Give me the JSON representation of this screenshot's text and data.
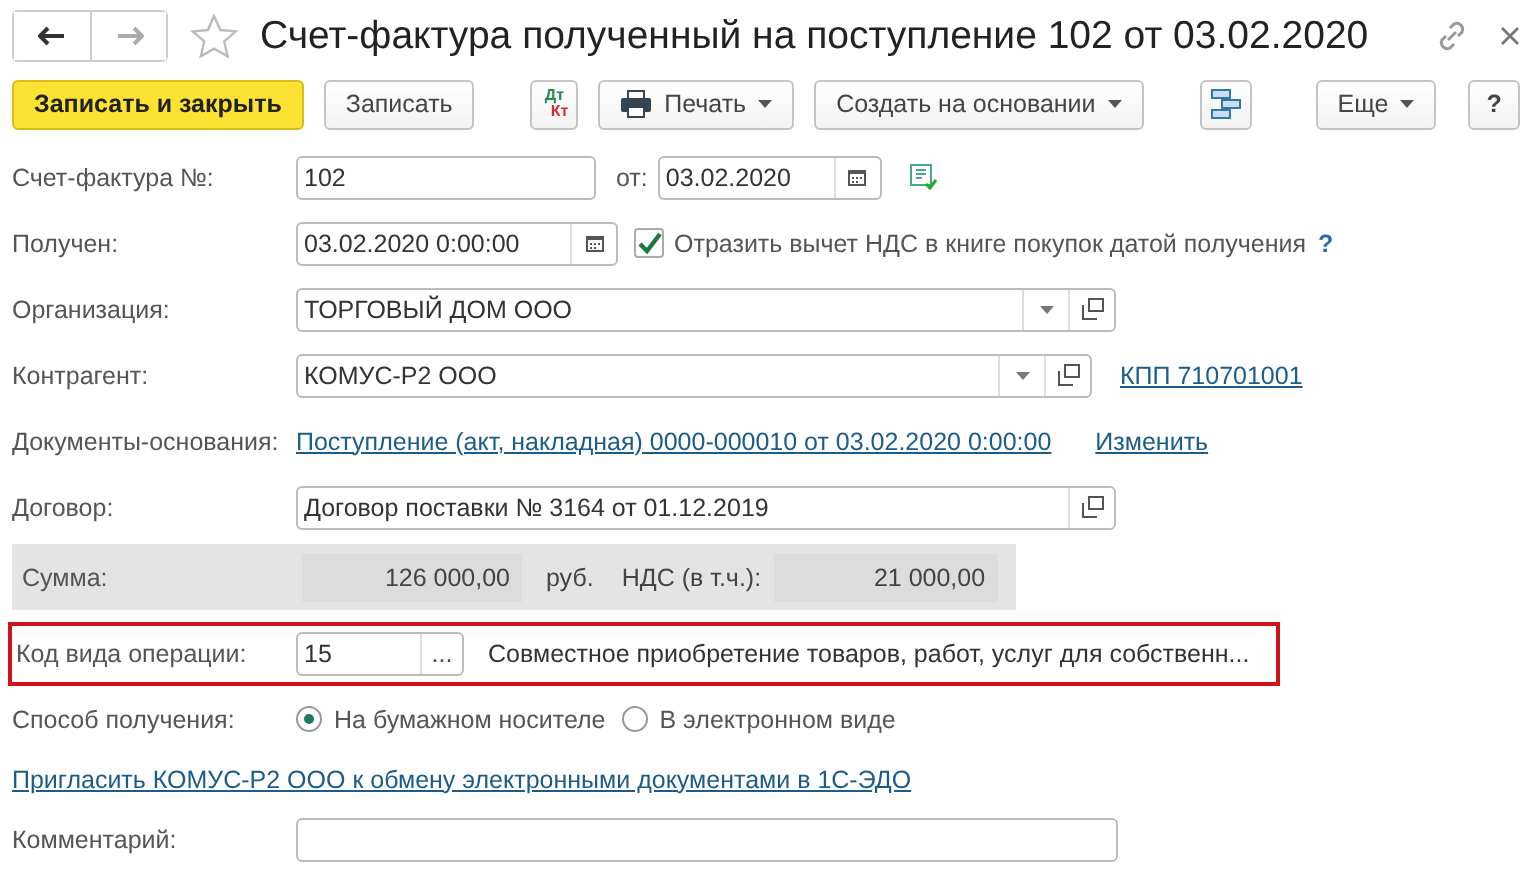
{
  "title": "Счет-фактура полученный на поступление 102 от 03.02.2020",
  "toolbar": [
    {
      "kind": "primary",
      "label": "Записать и закрыть"
    },
    {
      "kind": "button",
      "label": "Записать"
    },
    {
      "kind": "dtkt",
      "label": "Дт",
      "label2": "Кт"
    },
    {
      "kind": "print",
      "label": "Печать"
    },
    {
      "kind": "menu",
      "label": "Создать на основании"
    },
    {
      "kind": "structure"
    },
    {
      "kind": "menu",
      "label": "Еще"
    },
    {
      "kind": "button",
      "label": "?"
    }
  ],
  "invoice": {
    "label": "Счет-фактура №:",
    "number": "102",
    "date_label": "от:",
    "date": "03.02.2020"
  },
  "received": {
    "label": "Получен:",
    "value": "03.02.2020  0:00:00",
    "checkbox_label": "Отразить вычет НДС в книге покупок датой получения",
    "checked": true,
    "help": "?"
  },
  "organization": {
    "label": "Организация:",
    "value": "ТОРГОВЫЙ ДОМ ООО"
  },
  "counterparty": {
    "label": "Контрагент:",
    "value": "КОМУС-Р2 ООО",
    "link": "КПП 710701001"
  },
  "base_documents": {
    "label": "Документы-основания:",
    "link": "Поступление (акт, накладная) 0000-000010 от 03.02.2020 0:00:00",
    "action": "Изменить"
  },
  "contract": {
    "label": "Договор:",
    "value": "Договор поставки № 3164 от 01.12.2019"
  },
  "totals": {
    "label": "Сумма:",
    "amount": "126 000,00",
    "currency": "руб.",
    "vat_label": "НДС (в т.ч.):",
    "vat": "21 000,00"
  },
  "operation_code": {
    "label": "Код вида операции:",
    "value": "15",
    "button": "...",
    "description": "Совместное приобретение товаров, работ, услуг для собственн...",
    "highlighted": true
  },
  "receipt_method": {
    "label": "Способ получения:",
    "options": [
      {
        "label": "На бумажном носителе",
        "selected": true
      },
      {
        "label": "В электронном виде",
        "selected": false
      }
    ]
  },
  "invite_link": "Пригласить КОМУС-Р2 ООО к обмену электронными документами в 1С-ЭДО",
  "comment": {
    "label": "Комментарий:"
  }
}
